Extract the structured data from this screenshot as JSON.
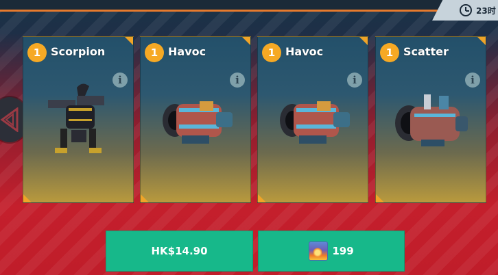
{
  "timer": {
    "text": "23时"
  },
  "cards": [
    {
      "level": "1",
      "name": "Scorpion",
      "info_icon": "info-icon",
      "art_name": "scorpion-robot-image"
    },
    {
      "level": "1",
      "name": "Havoc",
      "info_icon": "info-icon",
      "art_name": "havoc-weapon-image"
    },
    {
      "level": "1",
      "name": "Havoc",
      "info_icon": "info-icon",
      "art_name": "havoc-weapon-image"
    },
    {
      "level": "1",
      "name": "Scatter",
      "info_icon": "info-icon",
      "art_name": "scatter-weapon-image"
    }
  ],
  "buttons": {
    "price_label": "HK$14.90",
    "gem_amount": "199"
  },
  "colors": {
    "accent_orange": "#f0a428",
    "button_green": "#17b88a",
    "background_red": "#c41f2c"
  }
}
